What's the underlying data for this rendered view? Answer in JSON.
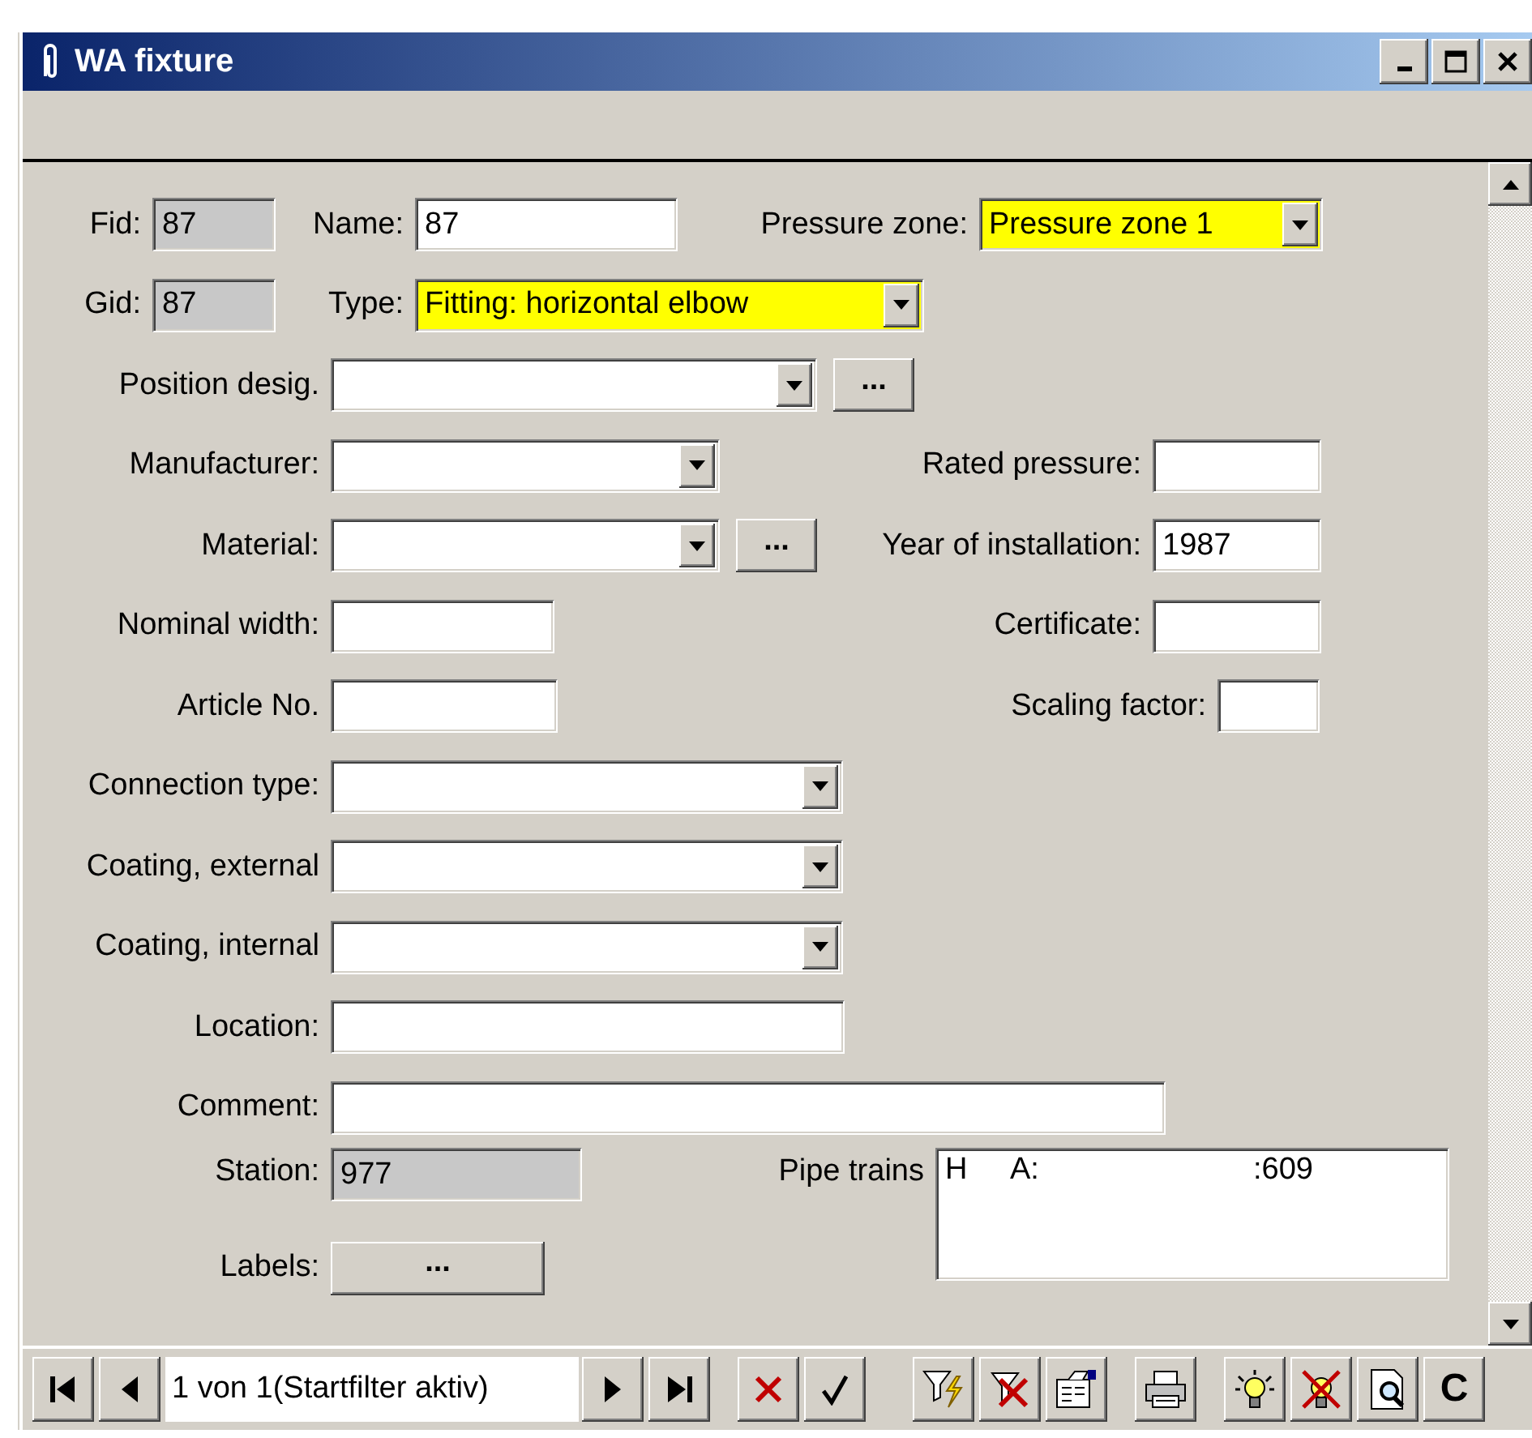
{
  "window": {
    "title": "WA fixture"
  },
  "form": {
    "rows": [
      [
        {
          "kind": "text",
          "label": "Fid:",
          "value": "87",
          "readonly": true,
          "highlighted": false
        },
        {
          "kind": "text",
          "label": "Name:",
          "value": "87",
          "readonly": false,
          "highlighted": false
        },
        {
          "kind": "combo",
          "label": "Pressure zone:",
          "value": "Pressure zone 1",
          "readonly": false,
          "highlighted": true
        }
      ],
      [
        {
          "kind": "text",
          "label": "Gid:",
          "value": "87",
          "readonly": true,
          "highlighted": false
        },
        {
          "kind": "combo",
          "label": "Type:",
          "value": "Fitting: horizontal elbow",
          "readonly": false,
          "highlighted": true
        }
      ],
      [
        {
          "kind": "combo",
          "label": "Position desig.",
          "readonly": false,
          "highlighted": false
        },
        {
          "kind": "button",
          "text": "..."
        }
      ],
      [
        {
          "kind": "combo",
          "label": "Manufacturer:",
          "readonly": false,
          "highlighted": false
        },
        {
          "kind": "text",
          "label": "Rated pressure:",
          "readonly": false,
          "highlighted": false
        }
      ],
      [
        {
          "kind": "combo",
          "label": "Material:",
          "readonly": false,
          "highlighted": false
        },
        {
          "kind": "button",
          "text": "..."
        },
        {
          "kind": "text",
          "label": "Year of installation:",
          "value": "1987",
          "readonly": false,
          "highlighted": false
        }
      ],
      [
        {
          "kind": "text",
          "label": "Nominal width:",
          "readonly": false,
          "highlighted": false
        },
        {
          "kind": "text",
          "label": "Certificate:",
          "readonly": false,
          "highlighted": false
        }
      ],
      [
        {
          "kind": "text",
          "label": "Article No.",
          "readonly": false,
          "highlighted": false
        },
        {
          "kind": "text",
          "label": "Scaling factor:",
          "readonly": false,
          "highlighted": false
        }
      ],
      [
        {
          "kind": "combo",
          "label": "Connection type:",
          "readonly": false,
          "highlighted": false
        }
      ],
      [
        {
          "kind": "combo",
          "label": "Coating, external",
          "readonly": false,
          "highlighted": false
        }
      ],
      [
        {
          "kind": "combo",
          "label": "Coating, internal",
          "readonly": false,
          "highlighted": false
        }
      ],
      [
        {
          "kind": "text",
          "label": "Location:",
          "readonly": false,
          "highlighted": false
        }
      ],
      [
        {
          "kind": "text",
          "label": "Comment:",
          "readonly": false,
          "highlighted": false
        }
      ],
      [
        {
          "kind": "text",
          "label": "Station:",
          "value": "977",
          "readonly": true,
          "highlighted": false
        },
        {
          "kind": "list",
          "label": "Pipe trains",
          "items": [
            {
              "cells": [
                "H",
                "A:",
                ":609"
              ]
            }
          ]
        }
      ],
      [
        {
          "kind": "button",
          "label": "Labels:",
          "text": "..."
        }
      ]
    ]
  },
  "toolbar": {
    "record": "1 von 1(Startfilter aktiv)",
    "letter_button": "C"
  }
}
